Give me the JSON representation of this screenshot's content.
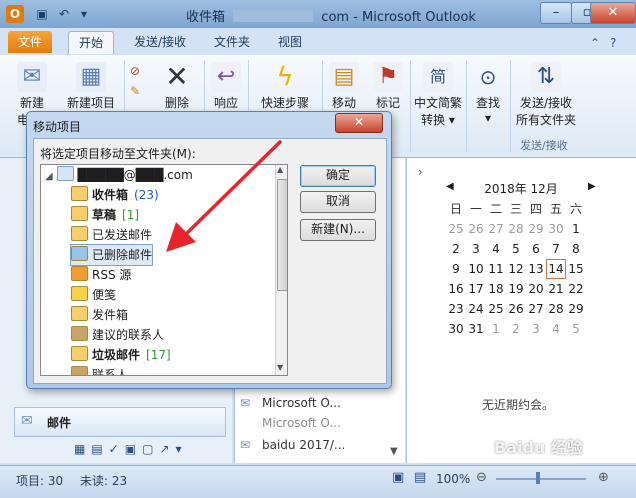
{
  "window": {
    "title": "收件箱 - ████_com - Microsoft Outlook",
    "title_left": "收件箱",
    "title_right": "com - Microsoft Outlook",
    "app_letter": "O",
    "minimize": "–",
    "maximize": "▫",
    "close": "✕"
  },
  "tabs": [
    {
      "label": "文件"
    },
    {
      "label": "开始"
    },
    {
      "label": "发送/接收"
    },
    {
      "label": "文件夹"
    },
    {
      "label": "视图"
    }
  ],
  "ribbon": {
    "buttons": [
      {
        "label": "新建",
        "label2": "电"
      },
      {
        "label": "新建项目"
      },
      {
        "label": "删除"
      },
      {
        "label": "响应"
      },
      {
        "label": "快速步骤"
      },
      {
        "label": "移动"
      },
      {
        "label": "标记"
      },
      {
        "label": "中文简繁",
        "label2": "转换"
      },
      {
        "label": "查找"
      },
      {
        "label": "发送/接收",
        "label2": "所有文件夹"
      }
    ],
    "group_label": "发送/接收"
  },
  "calendar": {
    "month_label": "2018年 12月",
    "weekdays": [
      "日",
      "一",
      "二",
      "三",
      "四",
      "五",
      "六"
    ],
    "rows": [
      [
        "25",
        "26",
        "27",
        "28",
        "29",
        "30",
        "1"
      ],
      [
        "2",
        "3",
        "4",
        "5",
        "6",
        "7",
        "8"
      ],
      [
        "9",
        "10",
        "11",
        "12",
        "13",
        "14",
        "15"
      ],
      [
        "16",
        "17",
        "18",
        "19",
        "20",
        "21",
        "22"
      ],
      [
        "23",
        "24",
        "25",
        "26",
        "27",
        "28",
        "29"
      ],
      [
        "30",
        "31",
        "1",
        "2",
        "3",
        "4",
        "5"
      ]
    ],
    "today": "14",
    "no_appointments": "无近期约会。"
  },
  "dialog": {
    "title": "移动项目",
    "close": "✕",
    "prompt": "将选定项目移动至文件夹(M):",
    "account": "█████@███.com",
    "folders": [
      {
        "label": "收件箱",
        "count": "(23)",
        "bold": true
      },
      {
        "label": "草稿",
        "count": "[1]",
        "bold": true
      },
      {
        "label": "已发送邮件",
        "count": ""
      },
      {
        "label": "已删除邮件",
        "count": "",
        "selected": true
      },
      {
        "label": "RSS 源",
        "count": ""
      },
      {
        "label": "便笺",
        "count": ""
      },
      {
        "label": "发件箱",
        "count": ""
      },
      {
        "label": "建议的联系人",
        "count": ""
      },
      {
        "label": "垃圾邮件",
        "count": "[17]",
        "bold": true
      },
      {
        "label": "联系人",
        "count": ""
      }
    ],
    "ok": "确定",
    "cancel": "取消",
    "new": "新建(N)..."
  },
  "nav": {
    "mail": "邮件"
  },
  "message_list": [
    {
      "text": "Microsoft O..."
    },
    {
      "text": "Microsoft O..."
    },
    {
      "text": "baidu 2017/..."
    }
  ],
  "status": {
    "items": "项目: 30",
    "unread": "未读: 23",
    "zoom": "100%"
  },
  "watermark": "Baidu 经验"
}
